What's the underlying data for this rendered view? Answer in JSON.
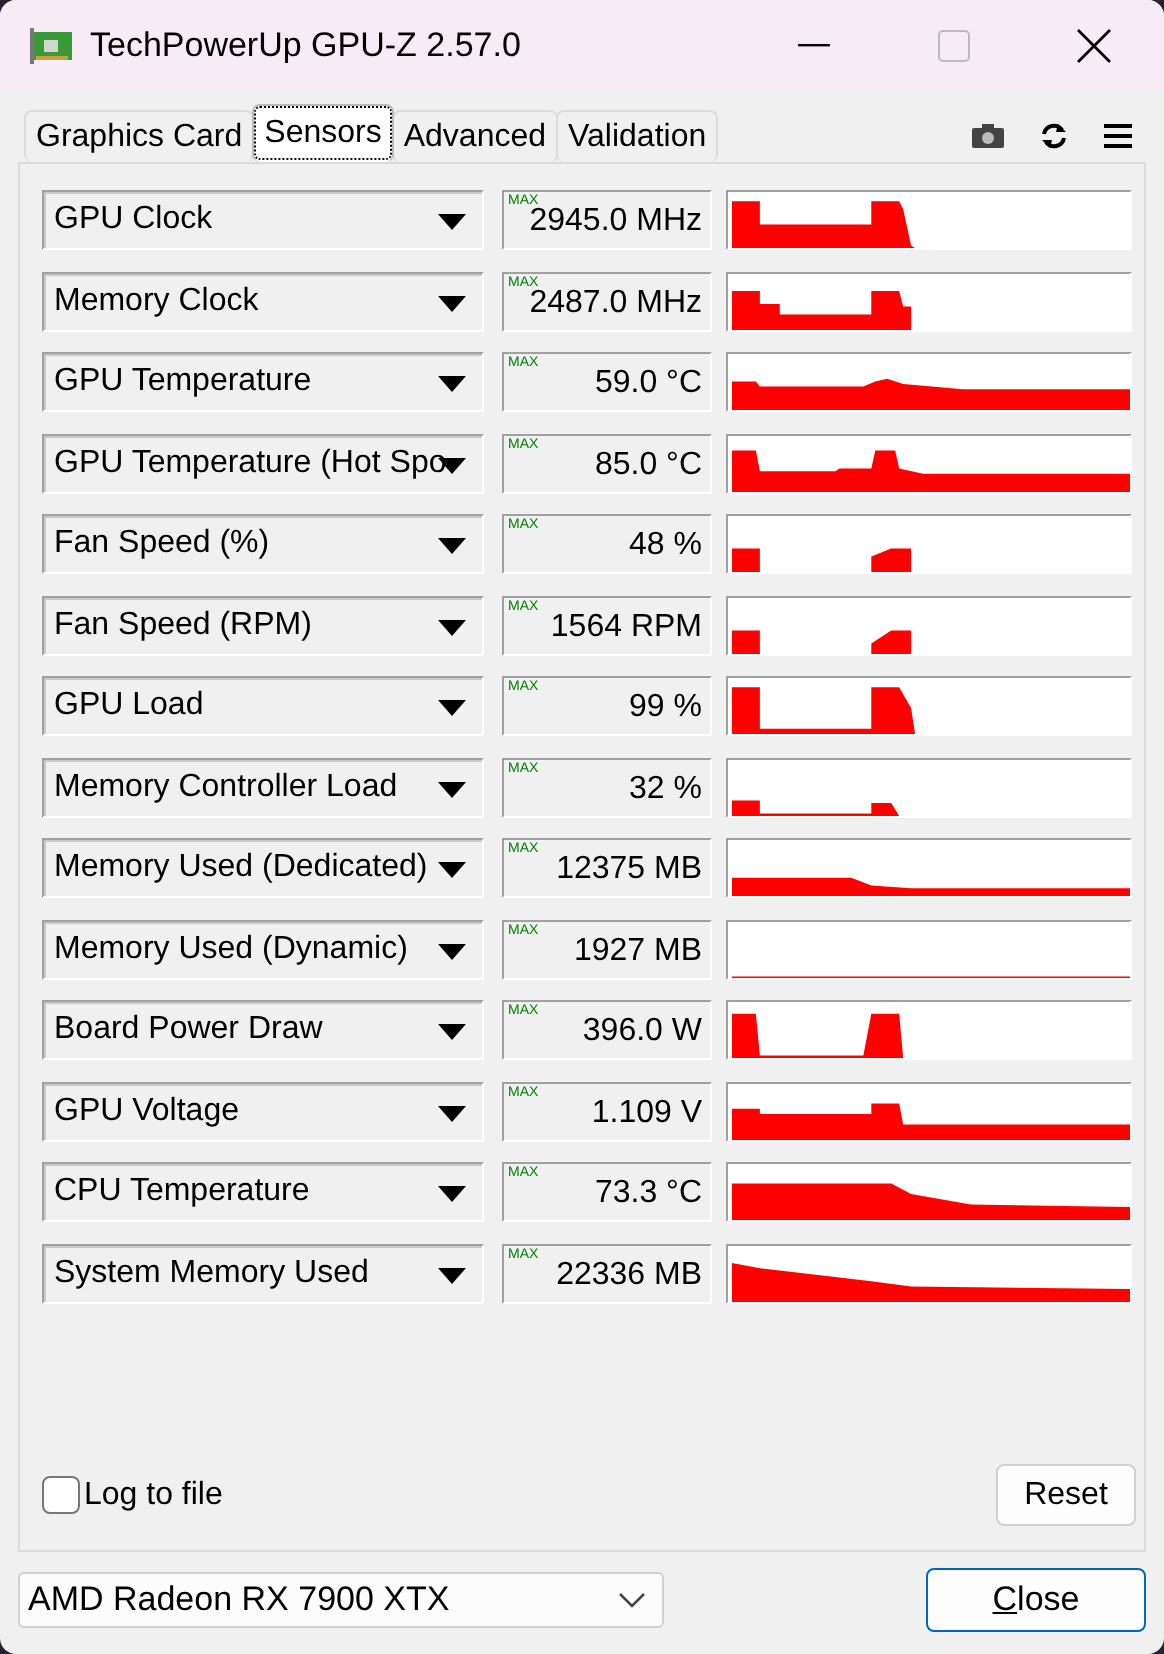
{
  "window": {
    "title": "TechPowerUp GPU-Z 2.57.0"
  },
  "tabs": [
    {
      "label": "Graphics Card",
      "selected": false
    },
    {
      "label": "Sensors",
      "selected": true
    },
    {
      "label": "Advanced",
      "selected": false
    },
    {
      "label": "Validation",
      "selected": false
    }
  ],
  "sensors": [
    {
      "name": "GPU Clock",
      "badge": "MAX",
      "value": "2945.0 MHz"
    },
    {
      "name": "Memory Clock",
      "badge": "MAX",
      "value": "2487.0 MHz"
    },
    {
      "name": "GPU Temperature",
      "badge": "MAX",
      "value": "59.0 °C"
    },
    {
      "name": "GPU Temperature (Hot Spo",
      "badge": "MAX",
      "value": "85.0 °C"
    },
    {
      "name": "Fan Speed (%)",
      "badge": "MAX",
      "value": "48 %"
    },
    {
      "name": "Fan Speed (RPM)",
      "badge": "MAX",
      "value": "1564 RPM"
    },
    {
      "name": "GPU Load",
      "badge": "MAX",
      "value": "99 %"
    },
    {
      "name": "Memory Controller Load",
      "badge": "MAX",
      "value": "32 %"
    },
    {
      "name": "Memory Used (Dedicated)",
      "badge": "MAX",
      "value": "12375 MB"
    },
    {
      "name": "Memory Used (Dynamic)",
      "badge": "MAX",
      "value": "1927 MB"
    },
    {
      "name": "Board Power Draw",
      "badge": "MAX",
      "value": "396.0 W"
    },
    {
      "name": "GPU Voltage",
      "badge": "MAX",
      "value": "1.109 V"
    },
    {
      "name": "CPU Temperature",
      "badge": "MAX",
      "value": "73.3 °C"
    },
    {
      "name": "System Memory Used",
      "badge": "MAX",
      "value": "22336 MB"
    }
  ],
  "log_to_file": {
    "label": "Log to file",
    "checked": false
  },
  "reset_button": "Reset",
  "gpu_select": {
    "value": "AMD Radeon RX 7900 XTX"
  },
  "close_button": {
    "label": "Close",
    "access_key_underlined": true
  }
}
